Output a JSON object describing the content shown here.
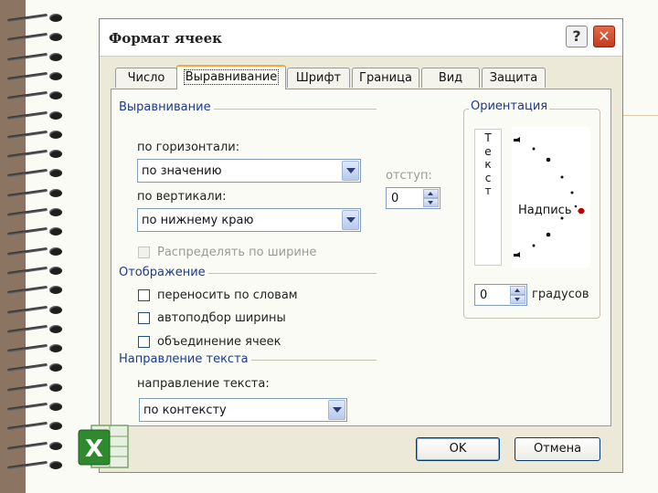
{
  "dialog": {
    "title": "Формат ячеек",
    "help_label": "?",
    "close_label": "✕"
  },
  "tabs": [
    {
      "label": "Число",
      "active": false
    },
    {
      "label": "Выравнивание",
      "active": true
    },
    {
      "label": "Шрифт",
      "active": false
    },
    {
      "label": "Граница",
      "active": false
    },
    {
      "label": "Вид",
      "active": false
    },
    {
      "label": "Защита",
      "active": false
    }
  ],
  "alignment": {
    "group_title": "Выравнивание",
    "horizontal_label": "по горизонтали:",
    "horizontal_value": "по значению",
    "vertical_label": "по вертикали:",
    "vertical_value": "по нижнему краю",
    "indent_label": "отступ:",
    "indent_value": "0",
    "distribute_label": "Распределять по ширине"
  },
  "display": {
    "group_title": "Отображение",
    "wrap_label": "переносить по словам",
    "shrink_label": "автоподбор ширины",
    "merge_label": "объединение ячеек"
  },
  "direction": {
    "group_title": "Направление текста",
    "label": "направление текста:",
    "value": "по контексту"
  },
  "orientation": {
    "group_title": "Ориентация",
    "vertical_text": [
      "Т",
      "е",
      "к",
      "с",
      "т"
    ],
    "dial_label": "Надпись",
    "degrees_value": "0",
    "degrees_label": "градусов",
    "marker_color": "#c00000"
  },
  "buttons": {
    "ok_label": "OK",
    "cancel_label": "Отмена"
  },
  "logo": {
    "icon": "excel-icon",
    "letter": "X"
  }
}
